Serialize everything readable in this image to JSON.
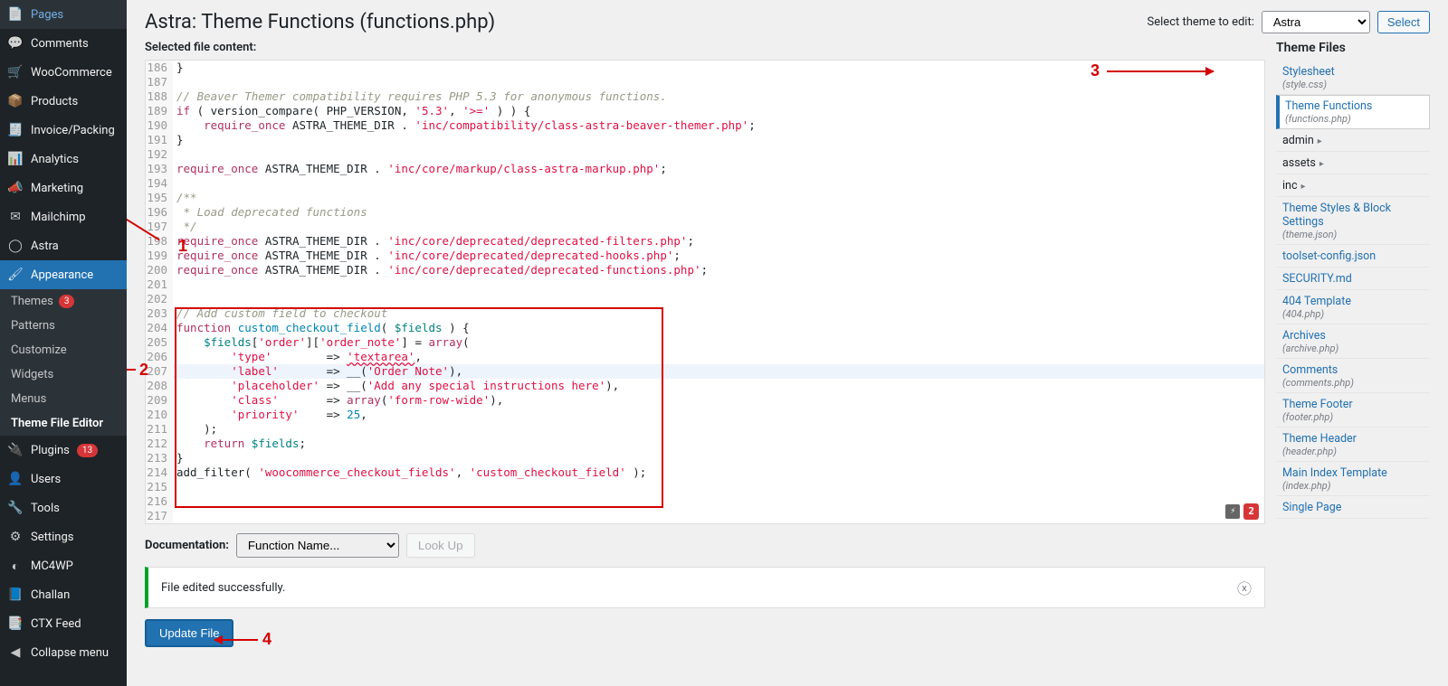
{
  "sidebar": {
    "items": [
      {
        "icon": "📄",
        "label": "Pages",
        "name": "pages"
      },
      {
        "icon": "💬",
        "label": "Comments",
        "name": "comments"
      },
      {
        "icon": "🛒",
        "label": "WooCommerce",
        "name": "woocommerce"
      },
      {
        "icon": "📦",
        "label": "Products",
        "name": "products"
      },
      {
        "icon": "🧾",
        "label": "Invoice/Packing",
        "name": "invoice"
      },
      {
        "icon": "📊",
        "label": "Analytics",
        "name": "analytics"
      },
      {
        "icon": "📣",
        "label": "Marketing",
        "name": "marketing"
      },
      {
        "icon": "✉",
        "label": "Mailchimp",
        "name": "mailchimp"
      },
      {
        "icon": "◯",
        "label": "Astra",
        "name": "astra"
      },
      {
        "icon": "🖌",
        "label": "Appearance",
        "name": "appearance",
        "active": true
      },
      {
        "icon": "🔌",
        "label": "Plugins",
        "name": "plugins",
        "badge": "13"
      },
      {
        "icon": "👤",
        "label": "Users",
        "name": "users"
      },
      {
        "icon": "🔧",
        "label": "Tools",
        "name": "tools"
      },
      {
        "icon": "⚙",
        "label": "Settings",
        "name": "settings"
      },
      {
        "icon": "◐",
        "label": "MC4WP",
        "name": "mc4wp"
      },
      {
        "icon": "📘",
        "label": "Challan",
        "name": "challan"
      },
      {
        "icon": "📑",
        "label": "CTX Feed",
        "name": "ctxfeed"
      },
      {
        "icon": "◀",
        "label": "Collapse menu",
        "name": "collapse"
      }
    ],
    "submenu": [
      {
        "label": "Themes",
        "badge": "3",
        "name": "themes"
      },
      {
        "label": "Patterns",
        "name": "patterns"
      },
      {
        "label": "Customize",
        "name": "customize"
      },
      {
        "label": "Widgets",
        "name": "widgets"
      },
      {
        "label": "Menus",
        "name": "menus"
      },
      {
        "label": "Theme File Editor",
        "name": "theme-file-editor",
        "active": true
      }
    ]
  },
  "header": {
    "title": "Astra: Theme Functions (functions.php)",
    "selectLabel": "Select theme to edit:",
    "selectedTheme": "Astra",
    "selectBtn": "Select"
  },
  "editor": {
    "subhead": "Selected file content:",
    "startLine": 186,
    "lines": [
      {
        "t": "}"
      },
      {
        "t": ""
      },
      {
        "t": "// Beaver Themer compatibility requires PHP 5.3 for anonymous functions.",
        "cls": "c-comment"
      },
      {
        "raw": "<span class='c-keyword'>if</span> ( version_compare( PHP_VERSION, <span class='c-string'>'5.3'</span>, <span class='c-string'>'>='</span> ) ) {"
      },
      {
        "raw": "    <span class='c-keyword'>require_once</span> ASTRA_THEME_DIR . <span class='c-string'>'inc/compatibility/class-astra-beaver-themer.php'</span>;"
      },
      {
        "t": "}"
      },
      {
        "t": ""
      },
      {
        "raw": "<span class='c-keyword'>require_once</span> ASTRA_THEME_DIR . <span class='c-string'>'inc/core/markup/class-astra-markup.php'</span>;"
      },
      {
        "t": ""
      },
      {
        "t": "/**",
        "cls": "c-comment"
      },
      {
        "t": " * Load deprecated functions",
        "cls": "c-comment"
      },
      {
        "t": " */",
        "cls": "c-comment"
      },
      {
        "raw": "<span class='c-keyword'>require_once</span> ASTRA_THEME_DIR . <span class='c-string'>'inc/core/deprecated/deprecated-filters.php'</span>;"
      },
      {
        "raw": "<span class='c-keyword'>require_once</span> ASTRA_THEME_DIR . <span class='c-string'>'inc/core/deprecated/deprecated-hooks.php'</span>;"
      },
      {
        "raw": "<span class='c-keyword'>require_once</span> ASTRA_THEME_DIR . <span class='c-string'>'inc/core/deprecated/deprecated-functions.php'</span>;"
      },
      {
        "t": ""
      },
      {
        "t": ""
      },
      {
        "raw": "<span class='c-comment'>// Add custom field to checkout</span>"
      },
      {
        "raw": "<span class='c-keyword'>function</span> <span class='c-func'>custom_checkout_field</span>( <span class='c-var'>$fields</span> ) {"
      },
      {
        "raw": "    <span class='c-var'>$fields</span>[<span class='c-string'>'order'</span>][<span class='c-string'>'order_note'</span>] = <span class='c-keyword'>array</span>("
      },
      {
        "raw": "        <span class='c-string'>'type'</span>        => <span class='c-string wavy'>'textarea'</span>,"
      },
      {
        "raw": "        <span class='c-string'>'label'</span>       => __(<span class='c-string'>'Order Note'</span>),",
        "hl": true
      },
      {
        "raw": "        <span class='c-string'>'placeholder'</span> => __(<span class='c-string'>'Add any special instructions here'</span>),"
      },
      {
        "raw": "        <span class='c-string'>'class'</span>       => <span class='c-keyword'>array</span>(<span class='c-string'>'form-row-wide'</span>),"
      },
      {
        "raw": "        <span class='c-string'>'priority'</span>    => <span class='c-func'>25</span>,"
      },
      {
        "raw": "    );"
      },
      {
        "raw": "    <span class='c-keyword'>return</span> <span class='c-var'>$fields</span>;"
      },
      {
        "t": "}"
      },
      {
        "raw": "add_filter( <span class='c-string'>'woocommerce_checkout_fields'</span>, <span class='c-string'>'custom_checkout_field'</span> );"
      },
      {
        "t": ""
      },
      {
        "t": ""
      },
      {
        "t": ""
      }
    ],
    "hintCount": "2"
  },
  "docRow": {
    "label": "Documentation:",
    "placeholder": "Function Name...",
    "lookup": "Look Up"
  },
  "notice": {
    "text": "File edited successfully."
  },
  "updateBtn": "Update File",
  "filesPanel": {
    "title": "Theme Files",
    "items": [
      {
        "label": "Stylesheet",
        "sub": "(style.css)",
        "name": "stylesheet"
      },
      {
        "label": "Theme Functions",
        "sub": "(functions.php)",
        "name": "functions",
        "active": true
      },
      {
        "label": "admin",
        "folder": true,
        "name": "admin"
      },
      {
        "label": "assets",
        "folder": true,
        "name": "assets"
      },
      {
        "label": "inc",
        "folder": true,
        "name": "inc"
      },
      {
        "label": "Theme Styles & Block Settings",
        "sub": "(theme.json)",
        "name": "themejson"
      },
      {
        "label": "toolset-config.json",
        "name": "toolset"
      },
      {
        "label": "SECURITY.md",
        "name": "security"
      },
      {
        "label": "404 Template",
        "sub": "(404.php)",
        "name": "404"
      },
      {
        "label": "Archives",
        "sub": "(archive.php)",
        "name": "archives"
      },
      {
        "label": "Comments",
        "sub": "(comments.php)",
        "name": "comments"
      },
      {
        "label": "Theme Footer",
        "sub": "(footer.php)",
        "name": "footer"
      },
      {
        "label": "Theme Header",
        "sub": "(header.php)",
        "name": "header"
      },
      {
        "label": "Main Index Template",
        "sub": "(index.php)",
        "name": "index"
      },
      {
        "label": "Single Page",
        "name": "singlepage"
      }
    ]
  },
  "annotations": {
    "a1": "1",
    "a2": "2",
    "a3": "3",
    "a4": "4"
  }
}
